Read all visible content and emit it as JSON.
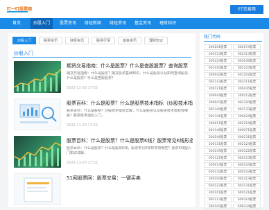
{
  "brand": {
    "logo_text": "叮一叮股票网",
    "cta_label": "ET交易网"
  },
  "nav": {
    "items": [
      "首页",
      "炒股入门",
      "股票资讯",
      "财经新闻",
      "财经资讯",
      "基金资讯",
      "理财知识"
    ],
    "active_index": 1
  },
  "subtabs": {
    "items": [
      "炒股入门",
      "股票资讯",
      "财经资讯",
      "股票行情",
      "基金资讯",
      "理财知识"
    ],
    "active_index": 0
  },
  "section": {
    "title": "炒股入门"
  },
  "articles": [
    {
      "title": "期货交易指南：什么是股票？什么是查股股票？查询股票",
      "desc": "期货交易指南：什么是股票？期货投资基础知识，什么是股票以及如何查询股票，什么是股票？什么是查股股票？",
      "time": "2021-11-23 17:52",
      "thumb": "green"
    },
    {
      "title": "股票百科：什么是股票？什么是股票技术指标（炒股技术指标）",
      "desc": "股票百科：什么是股票？炒股技术指标详解，什么是股票以及股票技术指标有哪些？股票技术指标入门。",
      "time": "2021-11-23 17:52",
      "thumb": "white"
    },
    {
      "title": "股票百科：什么是股票？什么是股票K线？股票常见K线形态",
      "desc": "股票百科：什么是股票？什么是股票K线，股票常见K线形态有哪些？股票K线图入门知识详解。",
      "time": "2021-11-23 17:52",
      "thumb": "green"
    },
    {
      "title": "51网股票网：股票交易：一键买卖",
      "desc": "",
      "time": "",
      "thumb": "white"
    }
  ],
  "sidebar": {
    "title": "热门代码",
    "rows": [
      [
        "300201股票",
        "600174股票"
      ],
      [
        "300113股票",
        "002413股票"
      ],
      [
        "300224股票",
        "002046股票"
      ],
      [
        "601010股票",
        "002125股票"
      ],
      [
        "300042股票",
        "601202股票"
      ],
      [
        "002143股票",
        "002311股票"
      ],
      [
        "300121股票",
        "300435股票"
      ],
      [
        "300044股票",
        "300112股票"
      ],
      [
        "300047股票",
        "002320股票"
      ],
      [
        "002344股票",
        "002133股票"
      ],
      [
        "002341股票",
        "300424股票"
      ],
      [
        "300011股票",
        "002214股票"
      ],
      [
        "002146股票",
        "600071股票"
      ],
      [
        "300246股票",
        "600131股票"
      ],
      [
        "300131股票",
        "002124股票"
      ],
      [
        "300245股票",
        "600122股票"
      ],
      [
        "002121股票",
        "600115股票"
      ],
      [
        "300014股票",
        "600124股票"
      ],
      [
        "600132股票",
        "600143股票"
      ],
      [
        "300100股票",
        "002213股票"
      ],
      [
        "600122股票",
        "002131股票"
      ],
      [
        "300101股票",
        "600121股票"
      ],
      [
        "002213股票",
        "600314股票"
      ],
      [
        "300102股票",
        "600234股票"
      ]
    ]
  }
}
